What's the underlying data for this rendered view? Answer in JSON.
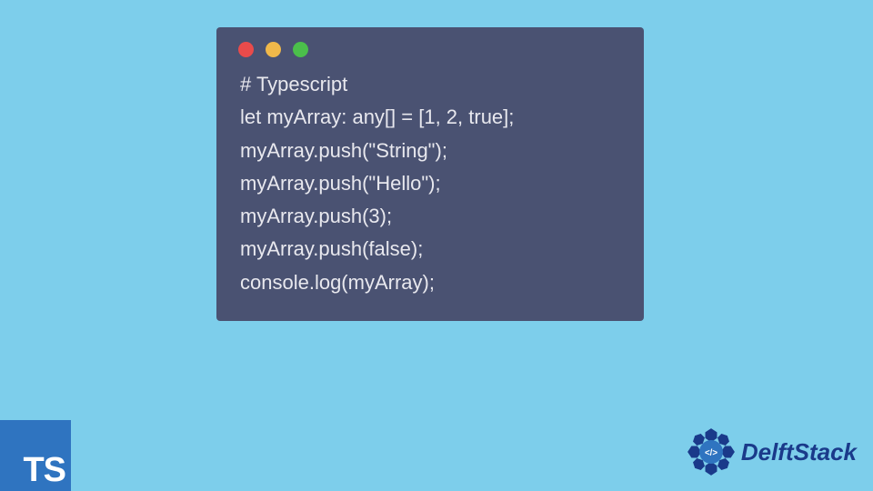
{
  "code": {
    "lines": [
      "# Typescript",
      "let myArray: any[] = [1, 2, true];",
      "myArray.push(\"String\");",
      "myArray.push(\"Hello\");",
      "myArray.push(3);",
      "myArray.push(false);",
      "console.log(myArray);"
    ]
  },
  "ts_badge": "TS",
  "brand": {
    "name": "DelftStack",
    "logo_symbol": "</>"
  },
  "colors": {
    "background": "#7dceeb",
    "window": "#4a5272",
    "ts_badge_bg": "#2f74c0",
    "brand_color": "#1a3a8a"
  }
}
